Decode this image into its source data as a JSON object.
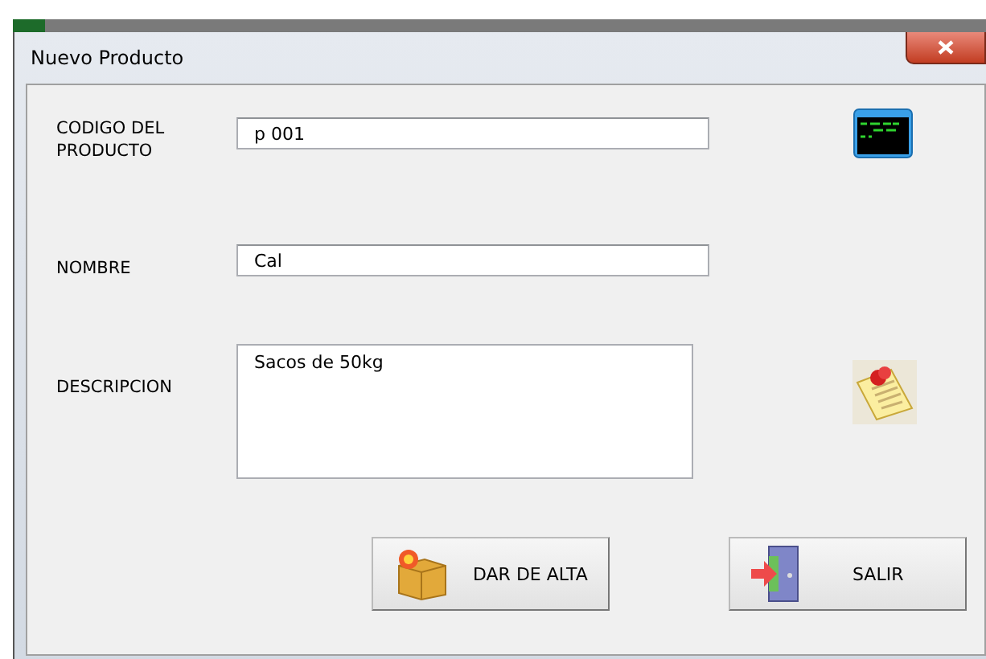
{
  "window": {
    "title": "Nuevo Producto"
  },
  "fields": [
    {
      "kind": "text",
      "label": "CODIGO DEL PRODUCTO",
      "value": "p 001"
    },
    {
      "kind": "text",
      "label": "NOMBRE",
      "value": "Cal"
    },
    {
      "kind": "textarea",
      "label": "DESCRIPCION",
      "value": "Sacos de 50kg"
    }
  ],
  "buttons": [
    {
      "label": "DAR DE ALTA"
    },
    {
      "label": "SALIR"
    }
  ]
}
